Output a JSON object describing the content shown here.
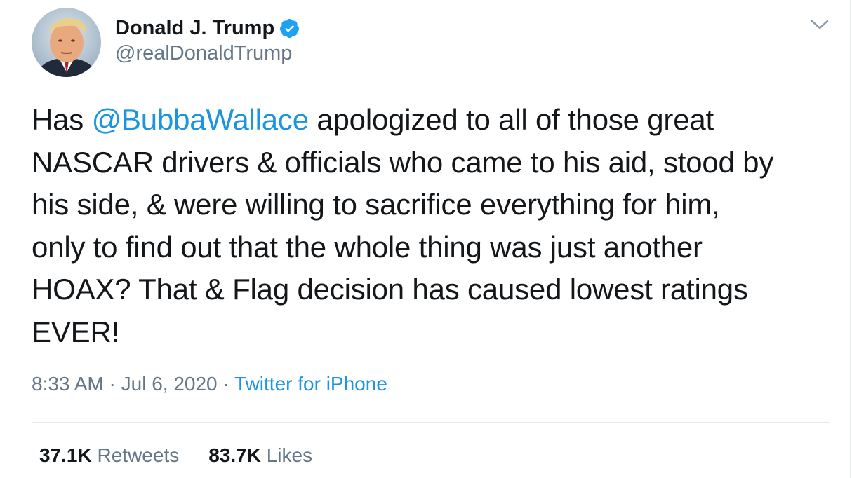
{
  "user": {
    "display_name": "Donald J. Trump",
    "handle": "@realDonaldTrump",
    "verified": true
  },
  "tweet": {
    "lines": [
      {
        "mention": "",
        "pre": "Has ",
        "mention_text": "@BubbaWallace",
        "post": " apologized to all of those great"
      },
      {
        "text": "NASCAR drivers & officials who came to his aid, stood by"
      },
      {
        "text": "his side, & were willing to sacrifice everything for him,"
      },
      {
        "text": "only to find out that the whole thing was just another"
      },
      {
        "text": "HOAX? That & Flag decision has caused lowest ratings"
      },
      {
        "text": "EVER!"
      }
    ]
  },
  "meta": {
    "time": "8:33 AM",
    "sep1": " · ",
    "date": "Jul 6, 2020",
    "sep2": " · ",
    "source": "Twitter for iPhone"
  },
  "stats": {
    "retweets_count": "37.1K",
    "retweets_label": "Retweets",
    "likes_count": "83.7K",
    "likes_label": "Likes"
  },
  "colors": {
    "link": "#1b95e0",
    "muted": "#657786",
    "text": "#14171a",
    "verified": "#1da1f2"
  },
  "icons": {
    "verified": "verified-badge-icon",
    "menu": "chevron-down-icon"
  }
}
